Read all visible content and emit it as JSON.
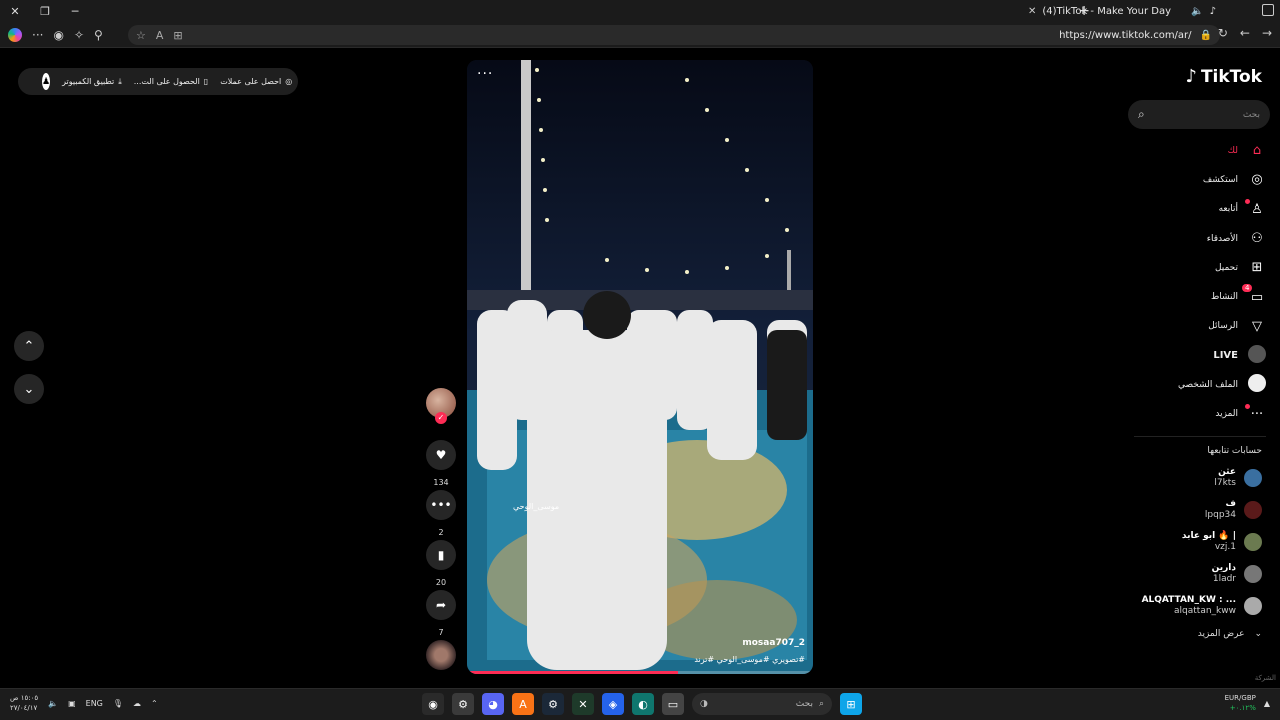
{
  "browser": {
    "tab_title": "(4)TikTok - Make Your Day",
    "url": "https://www.tiktok.com/ar/"
  },
  "promo": {
    "get_coins": "احصل على عملات",
    "get_app": "الحصول على الت...",
    "desktop_app": "تطبيق الكمبيوتر"
  },
  "video": {
    "author": "mosaa707_2",
    "caption": "#تصويري #موسى_الوحي #ترند",
    "overlay_text": "موسى_الوحي",
    "progress": 0.61,
    "likes": "134",
    "comments": "2",
    "saves": "20",
    "shares": "7"
  },
  "sidebar": {
    "logo": "TikTok",
    "search_placeholder": "بحث",
    "nav": [
      {
        "label": "لك",
        "icon": "home-icon"
      },
      {
        "label": "استكشف",
        "icon": "compass-icon"
      },
      {
        "label": "أتابعه",
        "icon": "user-follow-icon"
      },
      {
        "label": "الأصدقاء",
        "icon": "friends-icon"
      },
      {
        "label": "تحميل",
        "icon": "upload-icon"
      },
      {
        "label": "النشاط",
        "icon": "activity-icon",
        "badge": "4"
      },
      {
        "label": "الرسائل",
        "icon": "send-icon"
      },
      {
        "label": "LIVE",
        "icon": "live-avatar-icon"
      },
      {
        "label": "الملف الشخصي",
        "icon": "profile-avatar-icon"
      },
      {
        "label": "المزيد",
        "icon": "more-icon"
      }
    ],
    "following_title": "حسابات تتابعها",
    "following": [
      {
        "name": "عثن",
        "handle": "l7kts"
      },
      {
        "name": "ف",
        "handle": "lpqp34"
      },
      {
        "name": "ابو عابد 🔥 |",
        "handle": "vzj.1"
      },
      {
        "name": "دارين",
        "handle": "1ladr"
      },
      {
        "name": "ALQATTAN_KW : ...",
        "handle": "alqattan_kww"
      }
    ],
    "show_more": "عرض المزيد",
    "company": "الشركة"
  },
  "taskbar": {
    "time": "١٥:٠٥ ص",
    "date": "٢٧/٠٤/١٧",
    "language": "ENG",
    "search_placeholder": "بحث",
    "currency_pair": "EUR/GBP",
    "currency_change": "+٠.١٢%"
  },
  "colors": {
    "accent": "#fe2c55",
    "background": "#000000"
  }
}
